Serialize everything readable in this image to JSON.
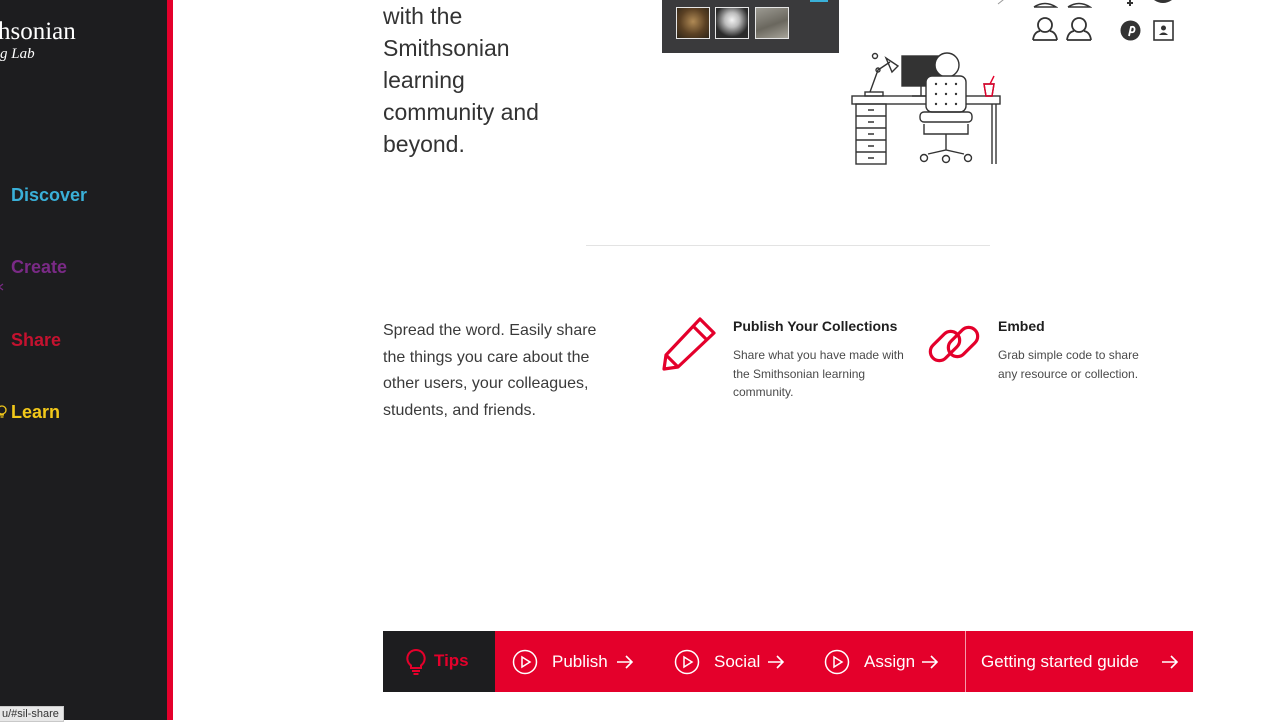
{
  "sidebar": {
    "logo_line1": "hsonian",
    "logo_line2": "g Lab",
    "nav": [
      {
        "label": "Discover",
        "color": "#3ab0d8"
      },
      {
        "label": "Create",
        "color": "#7a2a86"
      },
      {
        "label": "Share",
        "color": "#c4122f"
      },
      {
        "label": "Learn",
        "color": "#f2c81a"
      }
    ],
    "status_url": "u/#sil-share"
  },
  "intro": {
    "lines": [
      "with the",
      "Smithsonian",
      "learning",
      "community and",
      "beyond."
    ]
  },
  "share": {
    "intro_text": "Spread the word. Easily share the things you care about the other users, your colleagues, students, and friends.",
    "features": [
      {
        "title": "Publish Your Collections",
        "desc": "Share what you have made with the Smithsonian learning community.",
        "icon": "pencil-icon"
      },
      {
        "title": "Embed",
        "desc": "Grab simple code to share any resource or collection.",
        "icon": "link-icon"
      }
    ]
  },
  "tips_bar": {
    "tips_label": "Tips",
    "links": [
      {
        "label": "Publish"
      },
      {
        "label": "Social"
      },
      {
        "label": "Assign"
      }
    ],
    "guide_label": "Getting started guide"
  },
  "colors": {
    "accent_red": "#e4002b",
    "sidebar_bg": "#1d1d1f"
  }
}
